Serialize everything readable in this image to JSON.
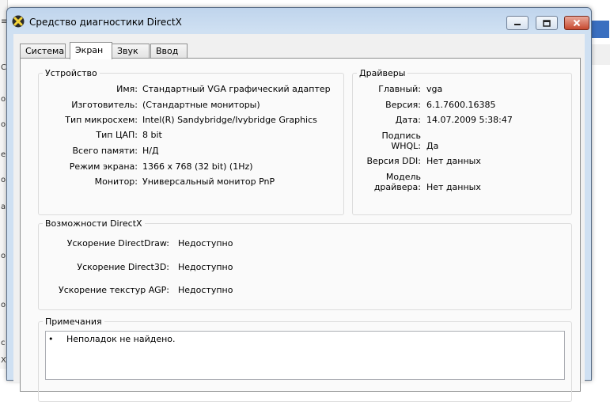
{
  "window": {
    "title": "Средство диагностики DirectX"
  },
  "tabs": [
    {
      "label": "Система"
    },
    {
      "label": "Экран"
    },
    {
      "label": "Звук"
    },
    {
      "label": "Ввод"
    }
  ],
  "device": {
    "title": "Устройство",
    "rows": [
      {
        "label": "Имя:",
        "value": "Стандартный VGA графический адаптер"
      },
      {
        "label": "Изготовитель:",
        "value": "(Стандартные мониторы)"
      },
      {
        "label": "Тип микросхем:",
        "value": "Intel(R) Sandybridge/Ivybridge Graphics"
      },
      {
        "label": "Тип ЦАП:",
        "value": "8 bit"
      },
      {
        "label": "Всего памяти:",
        "value": "Н/Д"
      },
      {
        "label": "Режим экрана:",
        "value": "1366 x 768 (32 bit) (1Hz)"
      },
      {
        "label": "Монитор:",
        "value": "Универсальный монитор PnP"
      }
    ]
  },
  "drivers": {
    "title": "Драйверы",
    "rows": [
      {
        "label": "Главный:",
        "value": "vga"
      },
      {
        "label": "Версия:",
        "value": "6.1.7600.16385"
      },
      {
        "label": "Дата:",
        "value": "14.07.2009 5:38:47"
      },
      {
        "label_line1": "Подпись",
        "label_line2": "WHQL:",
        "value": "Да"
      },
      {
        "label": "Версия DDI:",
        "value": "Нет данных"
      },
      {
        "label_line1": "Модель",
        "label_line2": "драйвера:",
        "value": "Нет данных"
      }
    ]
  },
  "directx": {
    "title": "Возможности DirectX",
    "rows": [
      {
        "label": "Ускорение DirectDraw:",
        "value": "Недоступно"
      },
      {
        "label": "Ускорение Direct3D:",
        "value": "Недоступно"
      },
      {
        "label": "Ускорение текстур AGP:",
        "value": "Недоступно"
      }
    ]
  },
  "notes": {
    "title": "Примечания",
    "bullet": "•",
    "items": [
      "Неполадок не найдено."
    ]
  },
  "background": {
    "edge_glyphs": [
      "≡",
      "С",
      "о",
      "о",
      "е",
      "о",
      "а",
      "о",
      "о",
      "с",
      "Х"
    ]
  },
  "icons": {
    "app": "directx-x-icon",
    "minimize": "minimize-icon",
    "maximize": "maximize-icon",
    "close": "close-icon"
  },
  "colors": {
    "title_gradient": "#cfe0f2",
    "close_button": "#c7492f",
    "panel_bg": "#fafafa"
  }
}
